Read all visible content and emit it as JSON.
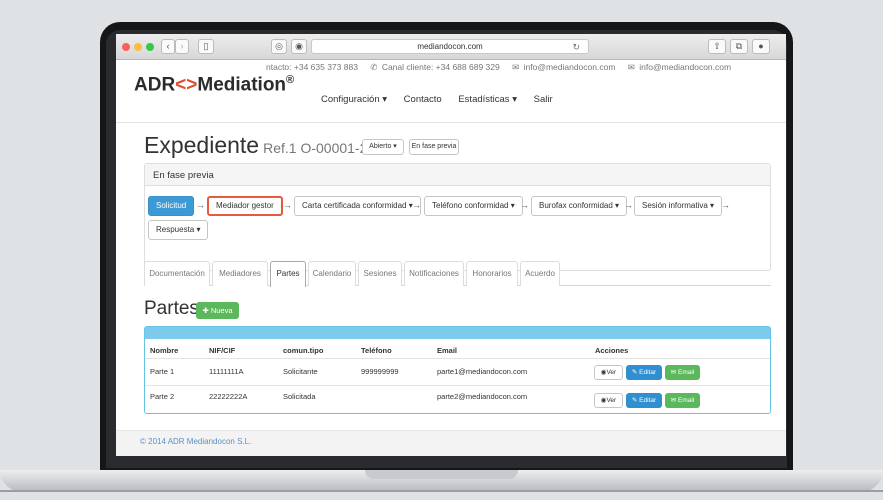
{
  "browser": {
    "url": "mediandocon.com"
  },
  "topbar": {
    "contact": "ntacto: +34 635 373 883",
    "canal": "Canal cliente: +34 688 689 329",
    "email1": "info@mediandocon.com",
    "email2": "info@mediandocon.com"
  },
  "logo": {
    "part1": "ADR",
    "part2": "<>",
    "part3": "Mediation",
    "reg": "®"
  },
  "nav": {
    "items": [
      "Configuración ▾",
      "Contacto",
      "Estadísticas ▾",
      "Salir"
    ]
  },
  "header": {
    "title": "Expediente",
    "ref": "Ref.1 O-00001-2014",
    "status_btn": "Abierto ▾",
    "phase_btn": "En fase previa"
  },
  "workflow": {
    "panel_title": "En fase previa",
    "steps": [
      "Solicitud",
      "Mediador gestor",
      "Carta certificada conformidad ▾",
      "Teléfono conformidad ▾",
      "Burofax conformidad ▾",
      "Sesión informativa ▾",
      "Respuesta ▾"
    ],
    "arrow": "→"
  },
  "tabs": [
    "Documentación",
    "Mediadores",
    "Partes",
    "Calendario",
    "Sesiones",
    "Notificaciones",
    "Honorarios",
    "Acuerdo"
  ],
  "partes": {
    "title": "Partes",
    "new_btn": "Nueva",
    "columns": [
      "Nombre",
      "NIF/CIF",
      "comun.tipo",
      "Teléfono",
      "Email",
      "Acciones"
    ],
    "rows": [
      [
        "Parte 1",
        "11111111A",
        "Solicitante",
        "999999999",
        "parte1@mediandocon.com"
      ],
      [
        "Parte 2",
        "22222222A",
        "Solicitada",
        "",
        "parte2@mediandocon.com"
      ]
    ],
    "actions": [
      "Ver",
      "Editar",
      "Email"
    ]
  },
  "footer": {
    "text": "© 2014 ADR Mediandocon S.L."
  },
  "colors": {
    "primary": "#3c9bd7",
    "success": "#5cb85c",
    "highlight": "#e35b3e",
    "table_header": "#7ccbec"
  }
}
